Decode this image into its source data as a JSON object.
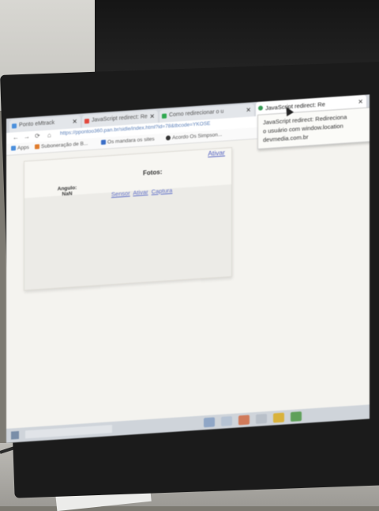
{
  "browser": {
    "tabs": [
      {
        "label": "Ponto eMtrack",
        "color": "#4a8fdc"
      },
      {
        "label": "JavaScript redirect: Re",
        "color": "#e2463b"
      },
      {
        "label": "Como redirecionar o u",
        "color": "#2fa84f"
      },
      {
        "label": "JavaScript redirect: Re",
        "color": "#3a9d57",
        "active": true
      }
    ],
    "tab_close_glyph": "✕",
    "tooltip": {
      "line1": "JavaScript redirect: Redireciona",
      "line2": "o usuário com window.location",
      "line3": "devmedia.com.br"
    },
    "url": "https://ppontoo360.pan.br/sidle/index.html?id=78&tbcode=YKOSE",
    "bookmarks": [
      {
        "label": "Apps",
        "color": "#4a8fdc"
      },
      {
        "label": "Suboneração de B...",
        "color": "#e07b2b"
      },
      {
        "label": "Os mandara os sites",
        "color": "#3b6fc7"
      },
      {
        "label": "Acordo Os Simpson...",
        "color": "#333333"
      }
    ]
  },
  "page": {
    "ativar_link": "Ativar",
    "fotos_label": "Fotos:",
    "angulo_label": "Angulo:",
    "angulo_sub": "NaN",
    "sensor_link": "Sensor",
    "ativar_link2": "Ativar",
    "captura_link": "Captura"
  }
}
